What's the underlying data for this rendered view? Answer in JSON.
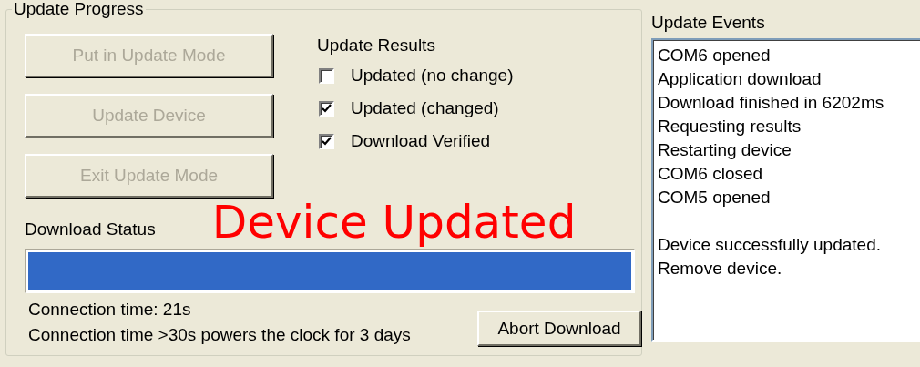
{
  "group": {
    "title": "Update Progress"
  },
  "buttons": [
    {
      "label": "Put in Update Mode",
      "disabled": true
    },
    {
      "label": "Update Device",
      "disabled": true
    },
    {
      "label": "Exit Update Mode",
      "disabled": true
    }
  ],
  "update_results": {
    "title": "Update Results",
    "options": [
      {
        "label": "Updated (no change)",
        "checked": false
      },
      {
        "label": "Updated (changed)",
        "checked": true
      },
      {
        "label": "Download Verified",
        "checked": true
      }
    ]
  },
  "status_banner": "Device Updated",
  "download_status": {
    "label": "Download Status",
    "level": 1.0
  },
  "connection_time": "Connection time: 21s",
  "connection_note": "Connection time >30s powers the clock for 3 days",
  "abort_button": {
    "label": "Abort Download",
    "disabled": false
  },
  "update_events": {
    "title": "Update Events",
    "blocks": [
      [
        "COM6 opened",
        "Application download",
        "Download finished in 6202ms",
        "Requesting results",
        "Restarting device",
        "COM6 closed",
        "COM5 opened"
      ],
      [
        "Device successfully updated.",
        "Remove device."
      ]
    ]
  }
}
